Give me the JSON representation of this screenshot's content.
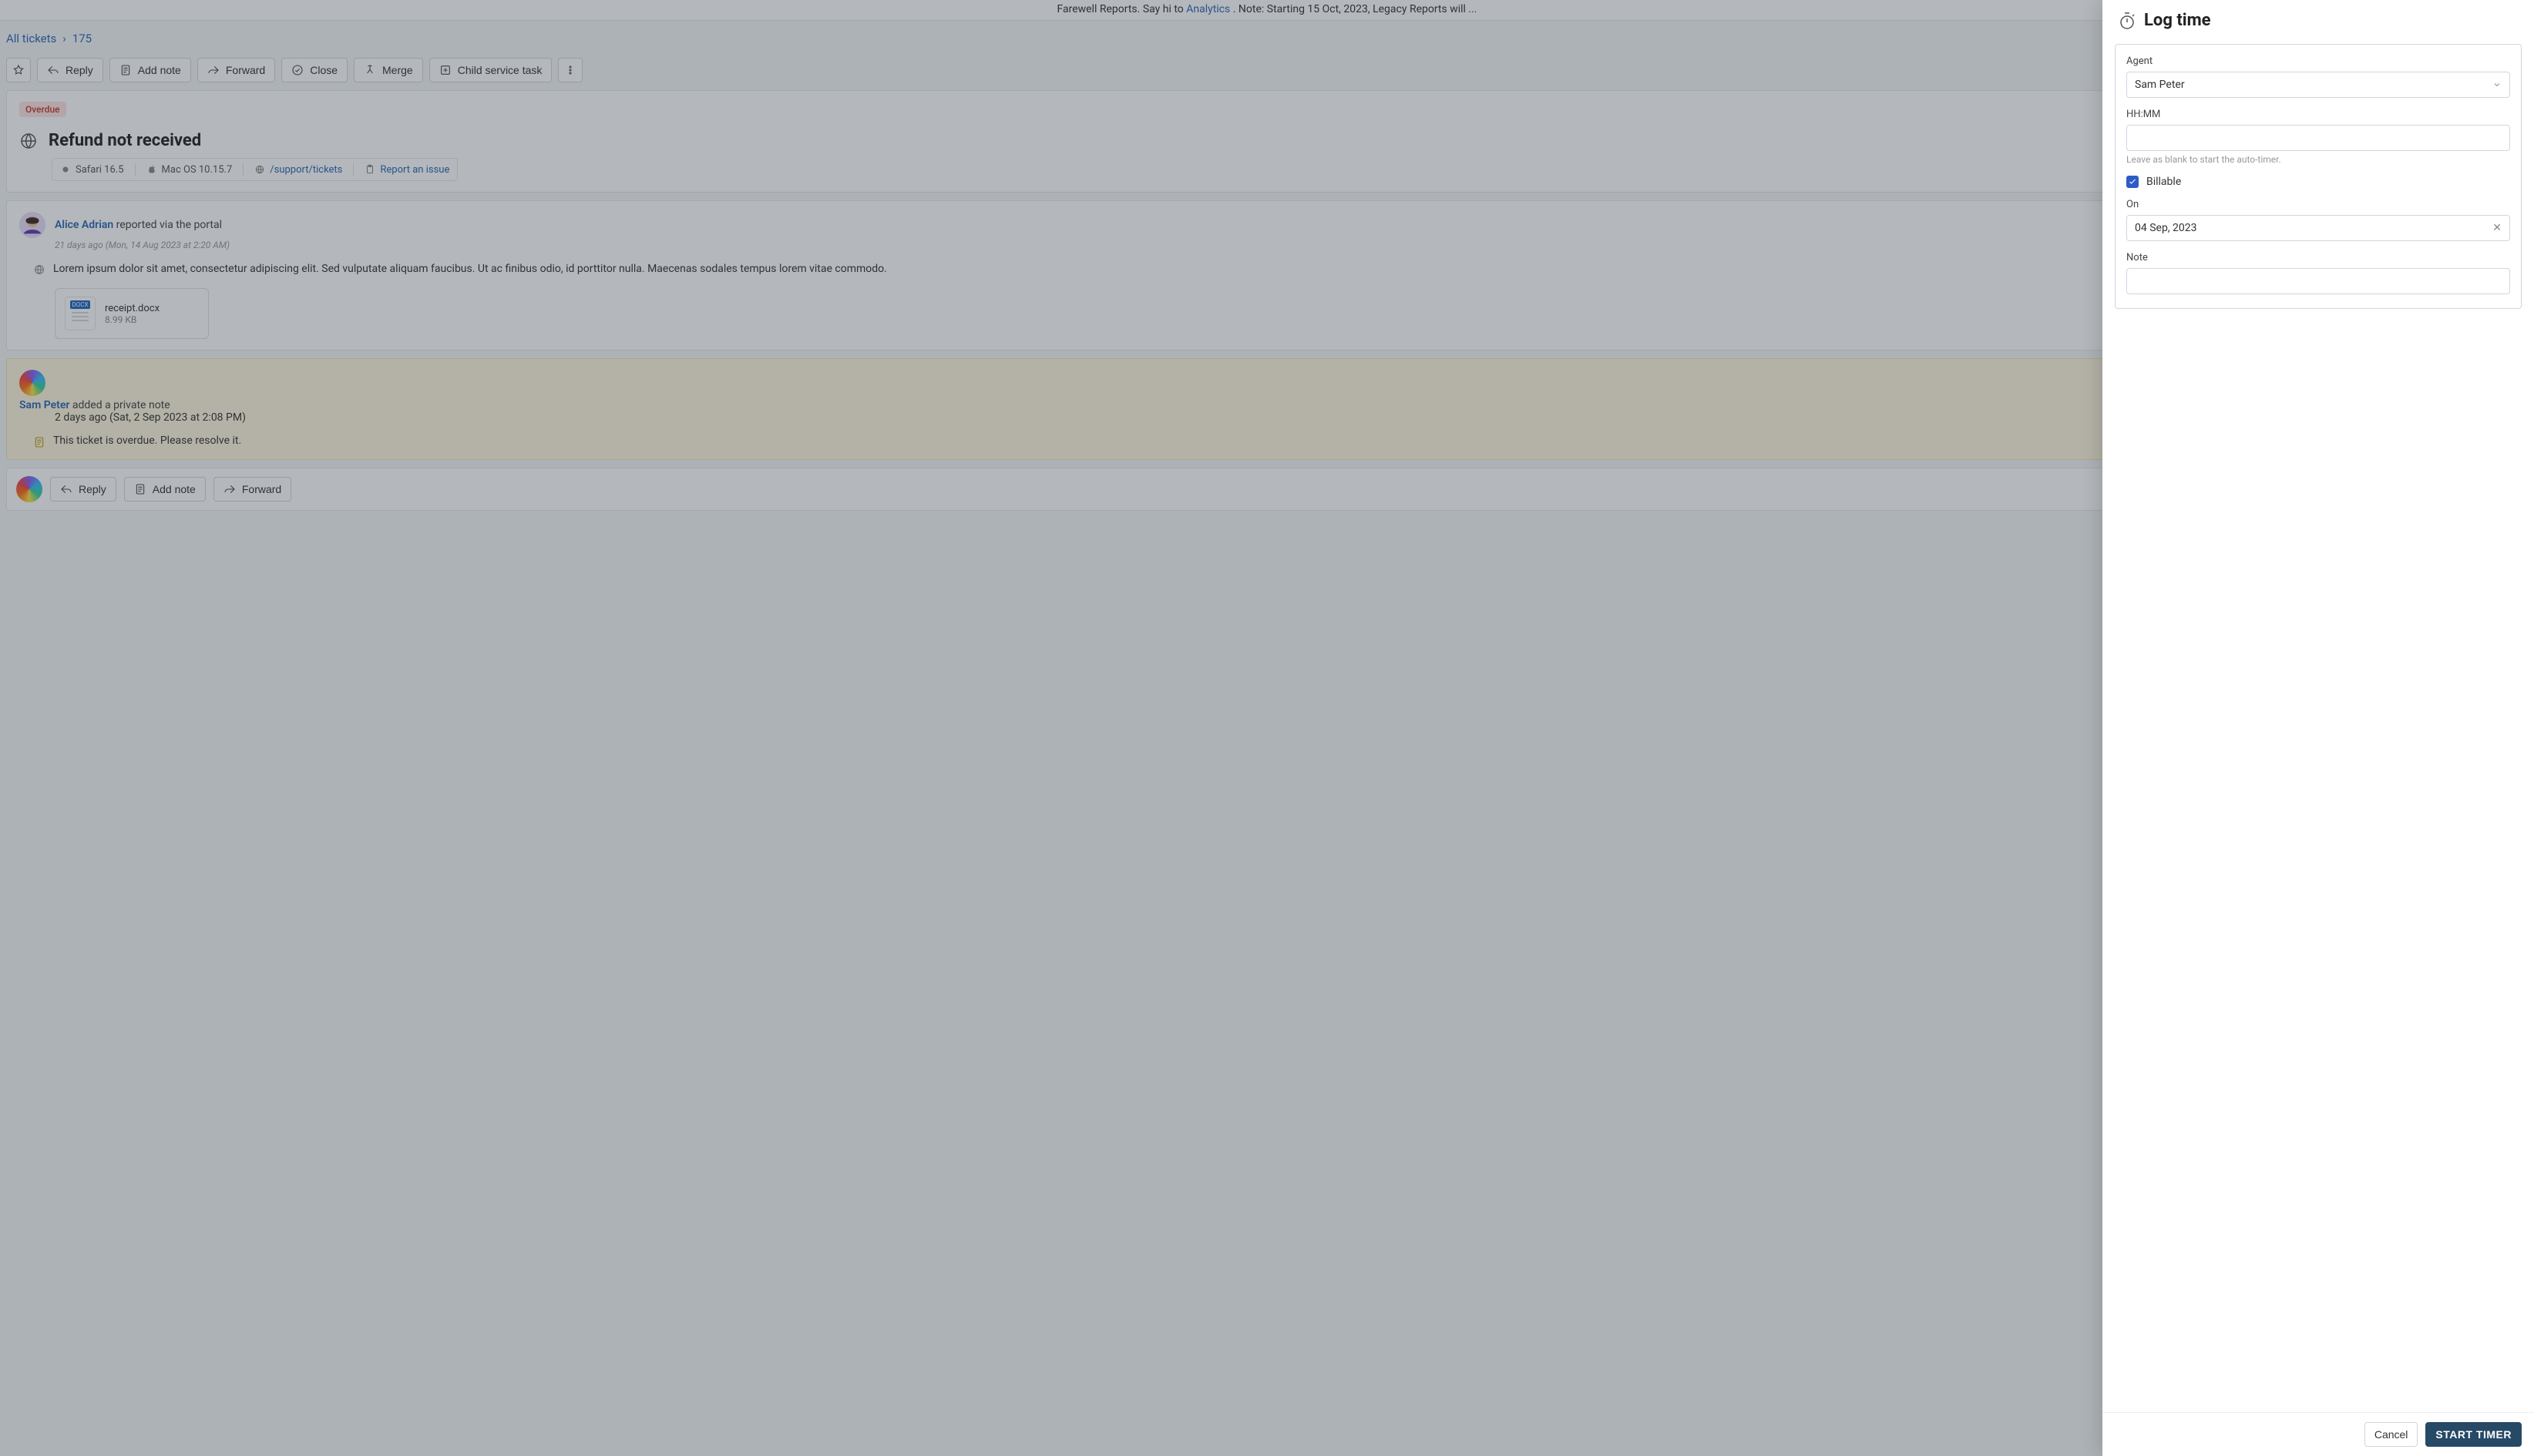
{
  "banner": {
    "prefix": "Farewell Reports. Say hi to ",
    "link_text": "Analytics",
    "suffix": ". Note: Starting 15 Oct, 2023, Legacy Reports will ..."
  },
  "breadcrumbs": {
    "all_tickets": "All tickets",
    "ticket_id": "175"
  },
  "toolbar": {
    "reply": "Reply",
    "add_note": "Add note",
    "forward": "Forward",
    "close": "Close",
    "merge": "Merge",
    "child_service_task": "Child service task"
  },
  "ticket": {
    "overdue_label": "Overdue",
    "title": "Refund not received",
    "sysinfo": {
      "browser": "Safari 16.5",
      "os": "Mac OS 10.15.7",
      "page_link": "/support/tickets",
      "report_issue": "Report an issue"
    }
  },
  "messages": [
    {
      "author_name": "Alice Adrian",
      "author_action": "reported via the portal",
      "timestamp": "21 days ago (Mon, 14 Aug 2023 at 2:20 AM)",
      "body": "Lorem ipsum dolor sit amet, consectetur adipiscing elit. Sed vulputate aliquam faucibus. Ut ac finibus odio, id porttitor nulla. Maecenas sodales tempus lorem vitae commodo.",
      "attachment": {
        "name": "receipt.docx",
        "size": "8.99 KB",
        "badge": "DOCX"
      }
    }
  ],
  "note": {
    "author_name": "Sam Peter",
    "author_action": "added a private note",
    "timestamp": "2 days ago (Sat, 2 Sep 2023 at 2:08 PM)",
    "body": "This ticket is overdue. Please resolve it."
  },
  "reply_bar": {
    "reply": "Reply",
    "add_note": "Add note",
    "forward": "Forward"
  },
  "panel": {
    "title": "Log time",
    "agent_label": "Agent",
    "agent_value": "Sam Peter",
    "hhmm_label": "HH:MM",
    "hhmm_value": "",
    "hhmm_helper": "Leave as blank to start the auto-timer.",
    "billable_label": "Billable",
    "billable_checked": true,
    "on_label": "On",
    "on_value": "04 Sep, 2023",
    "note_label": "Note",
    "note_value": "",
    "footer": {
      "cancel": "Cancel",
      "start_timer": "START TIMER"
    }
  }
}
